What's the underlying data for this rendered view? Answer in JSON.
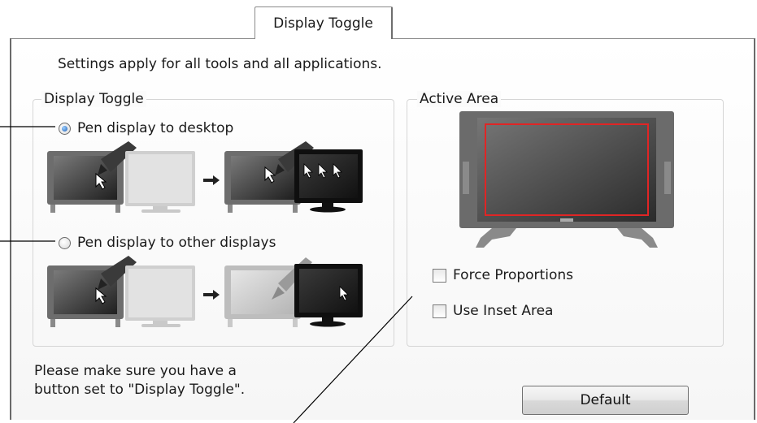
{
  "tab": {
    "label": "Display Toggle"
  },
  "intro_text": "Settings apply for all tools and all applications.",
  "display_toggle": {
    "legend": "Display Toggle",
    "options": [
      {
        "label": "Pen display to desktop",
        "checked": true
      },
      {
        "label": "Pen display to other displays",
        "checked": false
      }
    ]
  },
  "active_area": {
    "legend": "Active Area",
    "checkboxes": [
      {
        "label": "Force Proportions",
        "checked": false
      },
      {
        "label": "Use Inset Area",
        "checked": false
      }
    ]
  },
  "note": {
    "line1": "Please make sure you have a",
    "line2": "button set to \"Display Toggle\"."
  },
  "buttons": {
    "default_label": "Default"
  },
  "colors": {
    "active_area_outline": "#e02525",
    "radio_selected": "#1d5fb5",
    "panel_border": "#8f8f8f"
  }
}
